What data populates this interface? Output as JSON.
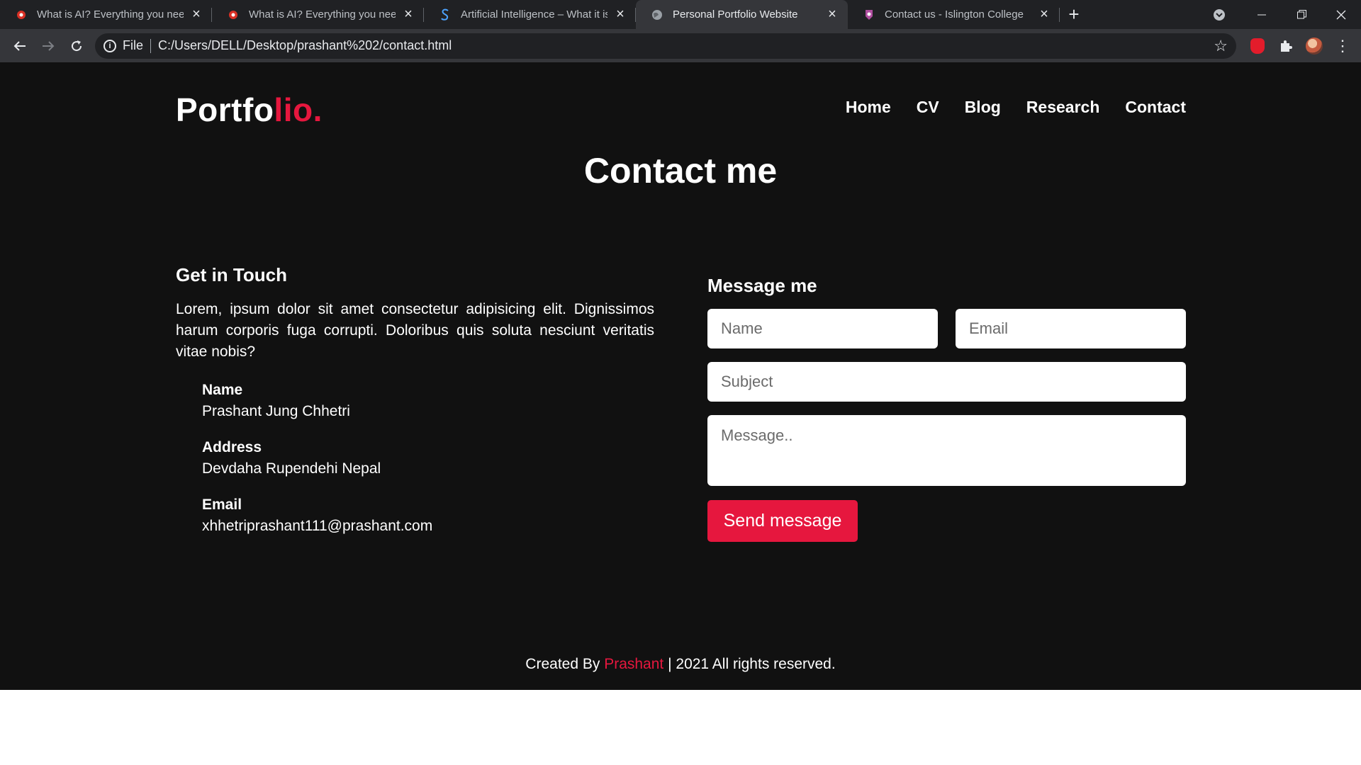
{
  "browser": {
    "tabs": [
      {
        "title": "What is AI? Everything you need",
        "icon": "red-circle-favicon",
        "active": false
      },
      {
        "title": "What is AI? Everything you need",
        "icon": "red-circle-favicon",
        "active": false
      },
      {
        "title": "Artificial Intelligence – What it is",
        "icon": "s-logo-favicon",
        "active": false
      },
      {
        "title": "Personal Portfolio Website",
        "icon": "globe-favicon",
        "active": true
      },
      {
        "title": "Contact us - Islington College",
        "icon": "college-favicon",
        "active": false
      }
    ],
    "address": {
      "scheme_label": "File",
      "url": "C:/Users/DELL/Desktop/prashant%202/contact.html"
    }
  },
  "site": {
    "logo_main": "Portfo",
    "logo_accent": "lio.",
    "nav": [
      "Home",
      "CV",
      "Blog",
      "Research",
      "Contact"
    ],
    "page_title": "Contact me",
    "accent_color": "#e6173e",
    "background_color": "#111111"
  },
  "contact_info": {
    "heading": "Get in Touch",
    "intro": "Lorem, ipsum dolor sit amet consectetur adipisicing elit. Dignissimos harum corporis fuga corrupti. Doloribus quis soluta nesciunt veritatis vitae nobis?",
    "items": [
      {
        "label": "Name",
        "value": "Prashant Jung Chhetri"
      },
      {
        "label": "Address",
        "value": "Devdaha Rupendehi Nepal"
      },
      {
        "label": "Email",
        "value": "xhhetriprashant111@prashant.com"
      }
    ]
  },
  "form": {
    "heading": "Message me",
    "name_placeholder": "Name",
    "email_placeholder": "Email",
    "subject_placeholder": "Subject",
    "message_placeholder": "Message..",
    "submit_label": "Send message"
  },
  "footer": {
    "prefix": "Created By",
    "author": "Prashant",
    "suffix": "| 2021 All rights reserved."
  }
}
